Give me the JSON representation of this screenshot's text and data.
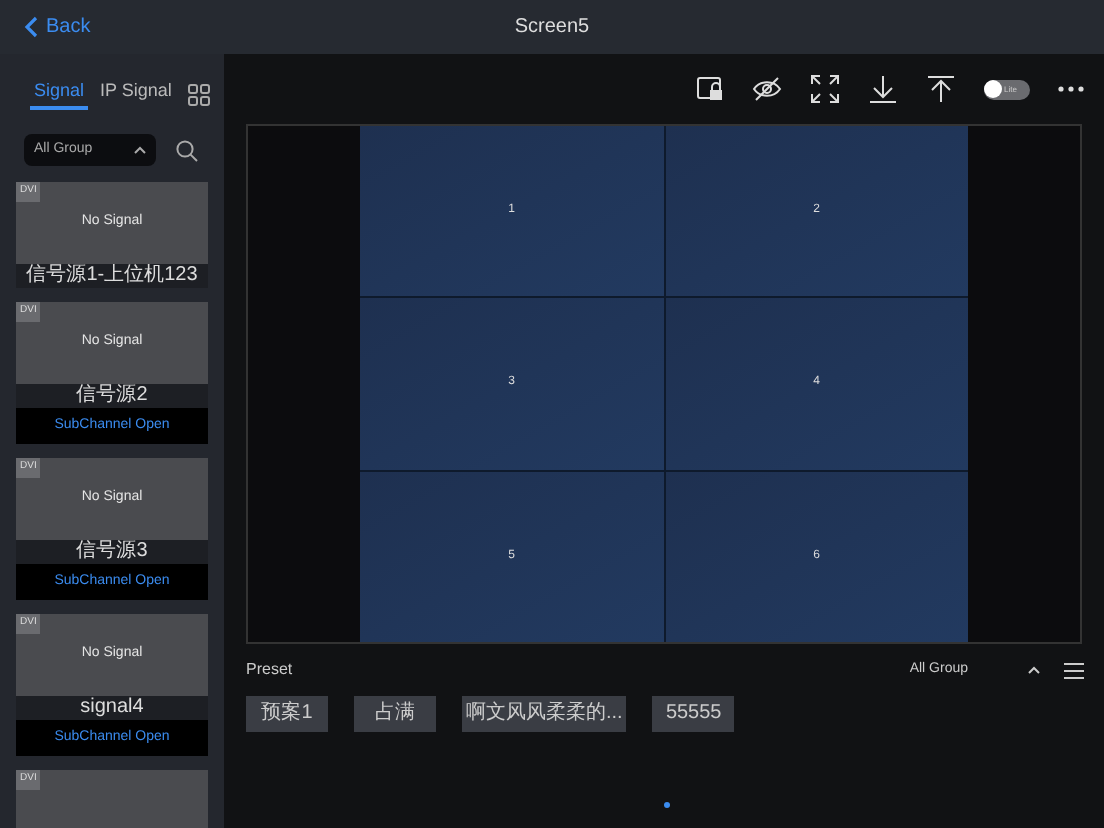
{
  "header": {
    "back": "Back",
    "title": "Screen5"
  },
  "sidebar": {
    "tabs": [
      {
        "label": "Signal",
        "selected": true
      },
      {
        "label": "IP Signal",
        "selected": false
      }
    ],
    "group": "All Group",
    "signals": [
      {
        "type": "DVI",
        "status": "No Signal",
        "name": "信号源1-上位机123"
      },
      {
        "type": "DVI",
        "status": "No Signal",
        "name": "信号源2",
        "subchannel": "SubChannel Open"
      },
      {
        "type": "DVI",
        "status": "No Signal",
        "name": "信号源3",
        "subchannel": "SubChannel Open"
      },
      {
        "type": "DVI",
        "status": "No Signal",
        "name": "signal4",
        "subchannel": "SubChannel Open"
      },
      {
        "type": "DVI"
      }
    ]
  },
  "toolbar": {
    "toggle": {
      "label": "Lite",
      "on": false
    }
  },
  "windows": [
    "1",
    "2",
    "3",
    "4",
    "5",
    "6"
  ],
  "preset": {
    "title": "Preset",
    "group": "All Group",
    "items": [
      "预案1",
      "占满",
      "啊文风风柔柔的...",
      "55555"
    ]
  }
}
